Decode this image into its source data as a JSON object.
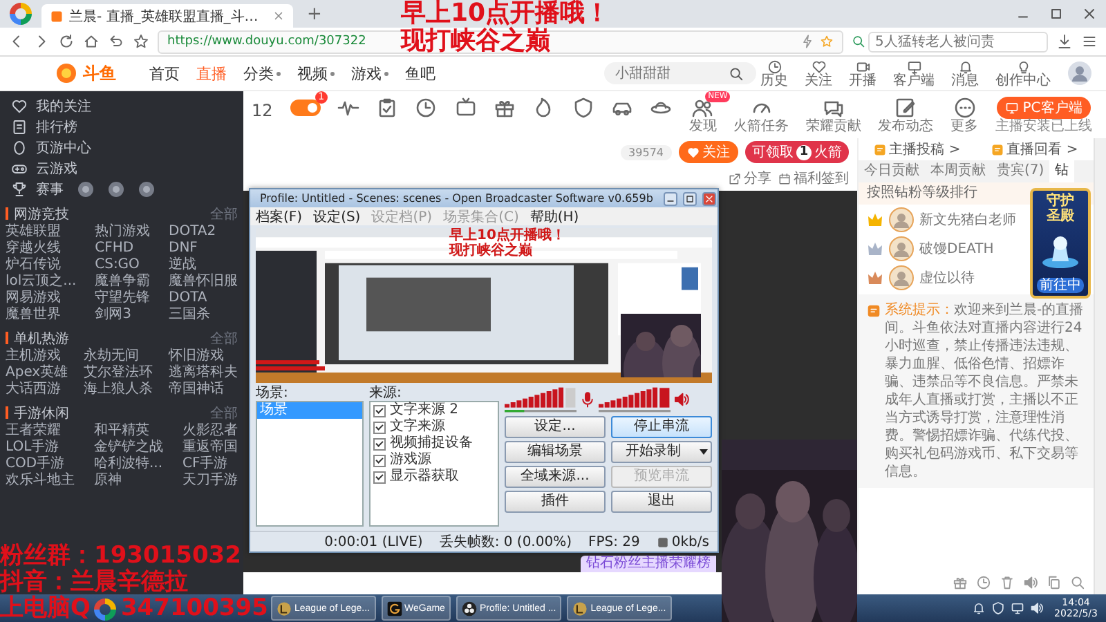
{
  "browser": {
    "tab": {
      "title": "兰晨- 直播_英雄联盟直播_斗…"
    },
    "new_tab": "+",
    "url": "https://www.douyu.com/307322",
    "search_placeholder": "5人猛转老人被问责"
  },
  "site_header": {
    "logo": "斗鱼",
    "nav": [
      {
        "label": "首页",
        "selected": false,
        "menu": false
      },
      {
        "label": "直播",
        "selected": true,
        "menu": false
      },
      {
        "label": "分类",
        "selected": false,
        "menu": true
      },
      {
        "label": "视频",
        "selected": false,
        "menu": true
      },
      {
        "label": "游戏",
        "selected": false,
        "menu": true
      },
      {
        "label": "鱼吧",
        "selected": false,
        "menu": false
      }
    ],
    "search_placeholder": "小甜甜甜",
    "tools": [
      {
        "label": "历史"
      },
      {
        "label": "关注"
      },
      {
        "label": "开播"
      },
      {
        "label": "客户端"
      },
      {
        "label": "消息"
      },
      {
        "label": "创作中心"
      }
    ]
  },
  "sidebar": {
    "items": [
      {
        "label": "我的关注"
      },
      {
        "label": "排行榜"
      },
      {
        "label": "页游中心"
      },
      {
        "label": "云游戏"
      },
      {
        "label": "赛事"
      }
    ],
    "sections": [
      {
        "title": "网游竞技",
        "more": "全部",
        "games": [
          "英雄联盟",
          "热门游戏",
          "DOTA2",
          "穿越火线",
          "CFHD",
          "DNF",
          "炉石传说",
          "CS:GO",
          "逆战",
          "lol云顶之...",
          "魔兽争霸",
          "魔兽怀旧服",
          "网易游戏",
          "守望先锋",
          "DOTA",
          "魔兽世界",
          "剑网3",
          "三国杀"
        ]
      },
      {
        "title": "单机热游",
        "more": "全部",
        "games": [
          "主机游戏",
          "永劫无间",
          "怀旧游戏",
          "Apex英雄",
          "艾尔登法环",
          "逃离塔科夫",
          "大话西游",
          "海上狼人杀",
          "帝国神话"
        ]
      },
      {
        "title": "手游休闲",
        "more": "全部",
        "games": [
          "王者荣耀",
          "和平精英",
          "火影忍者",
          "LOL手游",
          "金铲铲之战",
          "重返帝国",
          "COD手游",
          "哈利波特...",
          "CF手游",
          "欢乐斗地主",
          "原神",
          "天刀手游"
        ]
      }
    ]
  },
  "category_bar": {
    "day": "12",
    "live_badge": "1",
    "new_badge": "NEW",
    "items": [
      {
        "label": "发现"
      },
      {
        "label": "火箭任务"
      },
      {
        "label": "荣耀贡献"
      },
      {
        "label": "发布动态"
      },
      {
        "label": "更多"
      }
    ],
    "client_button": "PC客户端",
    "client_note": "主播安装已上线"
  },
  "room": {
    "followers": "39574",
    "follow_button": "关注",
    "rocket_badge": {
      "prefix": "可领取",
      "count": "1",
      "suffix": "火箭"
    },
    "share": "分享",
    "signin": "福利签到",
    "ranking_tag": "钻石粉丝主播荣耀榜"
  },
  "chat_panel": {
    "links": [
      {
        "label": "主播投稿 >"
      },
      {
        "label": "直播回看 >"
      }
    ],
    "tabs": [
      {
        "label": "今日贡献",
        "selected": false
      },
      {
        "label": "本周贡献",
        "selected": false
      },
      {
        "label": "贵宾(7)",
        "selected": false
      },
      {
        "label": "钻",
        "selected": true
      }
    ],
    "ranking_note": "按照钻粉等级排行",
    "ranking": [
      {
        "name": "新文先猪白老师",
        "color": "#f5b400"
      },
      {
        "name": "破馒DEATH",
        "color": "#a9b4c8"
      },
      {
        "name": "虚位以待",
        "color": "#d98a5a"
      }
    ],
    "notice_label": "系统提示：",
    "notice": "欢迎来到兰晨-的直播间。斗鱼依法对直播内容进行24小时巡查，禁止传播违法违规、暴力血腥、低俗色情、招嫖诈骗、违禁品等不良信息。严禁未成年人直播或打赏，主播以不正当方式诱导打赏，注意理性消费。警惕招嫖诈骗、代练代投、购买礼包码游戏币、私下交易等信息。",
    "promo": {
      "title": "守护圣殿",
      "button": "前往中"
    }
  },
  "obs": {
    "title": "Profile: Untitled - Scenes: scenes - Open Broadcaster Software v0.659b",
    "menu": [
      {
        "label": "档案(F)",
        "disabled": false
      },
      {
        "label": "设定(S)",
        "disabled": false
      },
      {
        "label": "设定档(P)",
        "disabled": true
      },
      {
        "label": "场景集合(C)",
        "disabled": true
      },
      {
        "label": "帮助(H)",
        "disabled": false
      }
    ],
    "preview_text": [
      "早上10点开播哦！",
      "现打峡谷之巅"
    ],
    "scenes_label": "场景:",
    "scenes": [
      {
        "label": "场景",
        "selected": true
      }
    ],
    "sources_label": "来源:",
    "sources": [
      {
        "label": "文字来源 2",
        "checked": true
      },
      {
        "label": "文字来源",
        "checked": true
      },
      {
        "label": "视频捕捉设备",
        "checked": true
      },
      {
        "label": "游戏源",
        "checked": true
      },
      {
        "label": "显示器获取",
        "checked": true
      }
    ],
    "buttons": [
      {
        "label": "设定...",
        "kind": "plain",
        "disabled": false,
        "focused": false
      },
      {
        "label": "停止串流",
        "kind": "plain",
        "disabled": false,
        "focused": true
      },
      {
        "label": "编辑场景",
        "kind": "plain",
        "disabled": false,
        "focused": false
      },
      {
        "label": "开始录制",
        "kind": "split",
        "disabled": false,
        "focused": false
      },
      {
        "label": "全域来源...",
        "kind": "plain",
        "disabled": false,
        "focused": false
      },
      {
        "label": "预览串流",
        "kind": "plain",
        "disabled": true,
        "focused": false
      },
      {
        "label": "插件",
        "kind": "plain",
        "disabled": false,
        "focused": false
      },
      {
        "label": "退出",
        "kind": "plain",
        "disabled": false,
        "focused": false
      }
    ],
    "status": [
      "0:00:01 (LIVE)",
      "丢失帧数: 0 (0.00%)",
      "FPS: 29",
      "0kb/s"
    ]
  },
  "overlay": {
    "top_lines": [
      "早上10点开播哦！",
      "现打峡谷之巅"
    ],
    "bottom_lines": [
      "粉丝群：193015032",
      "抖音：兰晨辛德拉"
    ],
    "qq_line": {
      "prefix": "上电脑Q",
      "number": "347100395"
    }
  },
  "taskbar": {
    "items": [
      {
        "label": "League of Lege...",
        "kind": "emblem"
      },
      {
        "label": "WeGame",
        "kind": "ring"
      },
      {
        "label": "Profile: Untitled ...",
        "kind": "disc"
      },
      {
        "label": "League of Lege...",
        "kind": "emblem"
      }
    ],
    "time": "14:04",
    "date": "2022/5/3"
  }
}
